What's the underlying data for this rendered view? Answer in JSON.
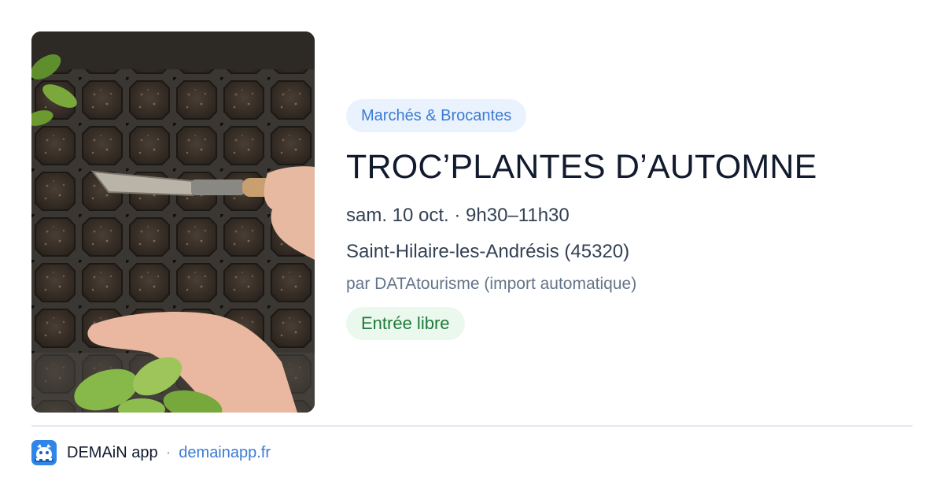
{
  "event": {
    "category": "Marchés & Brocantes",
    "title": "TROC’PLANTES D’AUTOMNE",
    "datetime": "sam. 10 oct. · 9h30–11h30",
    "location": "Saint-Hilaire-les-Andrésis (45320)",
    "source": "par DATAtourisme (import automatique)",
    "price": "Entrée libre",
    "image_icon": "seedling-tray-photo"
  },
  "footer": {
    "app_name": "DEMAiN app",
    "separator": "·",
    "link": "demainapp.fr",
    "app_icon": "demain-app-icon"
  },
  "colors": {
    "category_chip_bg": "#eaf2fd",
    "category_chip_text": "#3b7bd4",
    "price_chip_bg": "#ebf8ee",
    "price_chip_text": "#1f7a3a",
    "link": "#3b7bd4",
    "app_icon": "#2f86e8"
  }
}
